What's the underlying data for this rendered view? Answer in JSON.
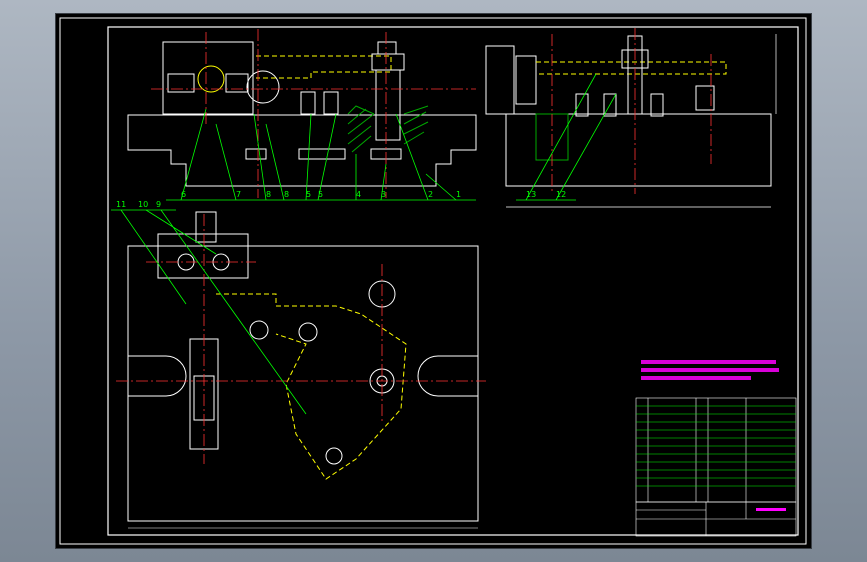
{
  "colors": {
    "background": "#000000",
    "outline": "#ffffff",
    "hidden_line": "#ffff00",
    "center_line": "#ff3030",
    "leader": "#00ff00",
    "note_text": "#ff00ff",
    "section_hatch": "#00aa00"
  },
  "drawing": {
    "front_view_callouts": [
      "6",
      "7",
      "8",
      "8",
      "5",
      "5",
      "4",
      "3",
      "2",
      "1"
    ],
    "side_view_callouts": [
      "13",
      "12"
    ],
    "top_view_callouts": [
      "11",
      "10",
      "9"
    ]
  }
}
